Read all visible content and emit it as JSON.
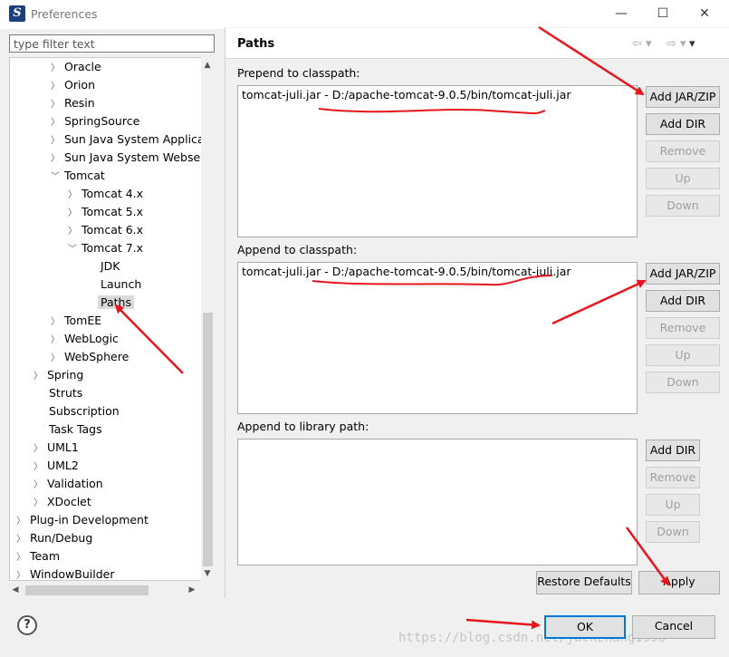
{
  "window": {
    "title": "Preferences",
    "minimize_icon": "—",
    "maximize_icon": "☐",
    "close_icon": "✕"
  },
  "filter": {
    "placeholder": "type filter text",
    "value": ""
  },
  "tree": {
    "items": [
      {
        "label": "Oracle"
      },
      {
        "label": "Orion"
      },
      {
        "label": "Resin"
      },
      {
        "label": "SpringSource"
      },
      {
        "label": "Sun Java System Applicati"
      },
      {
        "label": "Sun Java System Webserv"
      },
      {
        "label": "Tomcat"
      },
      {
        "label": "Tomcat  4.x"
      },
      {
        "label": "Tomcat  5.x"
      },
      {
        "label": "Tomcat  6.x"
      },
      {
        "label": "Tomcat  7.x"
      },
      {
        "label": "JDK"
      },
      {
        "label": "Launch"
      },
      {
        "label": "Paths"
      },
      {
        "label": "TomEE"
      },
      {
        "label": "WebLogic"
      },
      {
        "label": "WebSphere"
      },
      {
        "label": "Spring"
      },
      {
        "label": "Struts"
      },
      {
        "label": "Subscription"
      },
      {
        "label": "Task Tags"
      },
      {
        "label": "UML1"
      },
      {
        "label": "UML2"
      },
      {
        "label": "Validation"
      },
      {
        "label": "XDoclet"
      },
      {
        "label": "Plug-in Development"
      },
      {
        "label": "Run/Debug"
      },
      {
        "label": "Team"
      },
      {
        "label": "WindowBuilder"
      }
    ],
    "selected": "Paths"
  },
  "panel": {
    "title": "Paths",
    "prepend": {
      "label": "Prepend to classpath:",
      "entry": "tomcat-juli.jar - D:/apache-tomcat-9.0.5/bin/tomcat-juli.jar",
      "buttons": {
        "add_jar": "Add JAR/ZIP",
        "add_dir": "Add DIR",
        "remove": "Remove",
        "up": "Up",
        "down": "Down"
      }
    },
    "append": {
      "label": "Append to classpath:",
      "entry": "tomcat-juli.jar - D:/apache-tomcat-9.0.5/bin/tomcat-juli.jar",
      "buttons": {
        "add_jar": "Add JAR/ZIP",
        "add_dir": "Add DIR",
        "remove": "Remove",
        "up": "Up",
        "down": "Down"
      }
    },
    "library": {
      "label": "Append to library path:",
      "buttons": {
        "add_dir": "Add DIR",
        "remove": "Remove",
        "up": "Up",
        "down": "Down"
      }
    },
    "restore_label": "Restore Defaults",
    "apply_label": "Apply"
  },
  "footer": {
    "help_icon": "?",
    "ok_label": "OK",
    "cancel_label": "Cancel"
  },
  "watermark": "https://blog.csdn.net/jackzhang1996",
  "icons": [
    "app-icon",
    "back-arrow-icon",
    "forward-arrow-icon",
    "menu-dropdown-icon",
    "help-icon",
    "chevron-right-icon",
    "chevron-down-icon"
  ],
  "colors": {
    "annotation_red": "#e8161c",
    "ok_focus": "#0078d7"
  }
}
